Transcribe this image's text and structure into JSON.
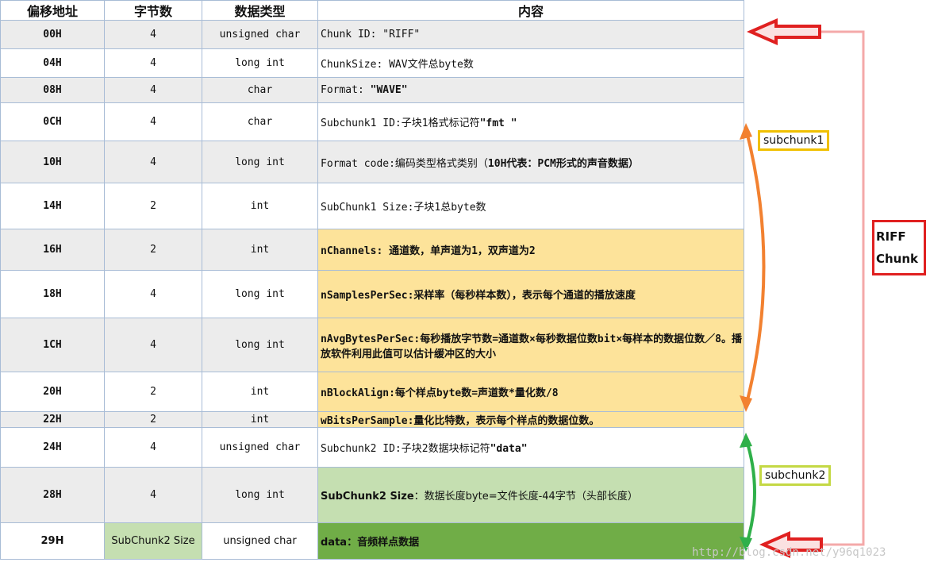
{
  "headers": {
    "offset": "偏移地址",
    "bytes": "字节数",
    "type": "数据类型",
    "content": "内容"
  },
  "rows": [
    {
      "offset": "00H",
      "bytes": "4",
      "type": "unsigned char",
      "desc": "Chunk ID: \"RIFF\""
    },
    {
      "offset": "04H",
      "bytes": "4",
      "type": "long int",
      "desc": "ChunkSize: WAV文件总byte数"
    },
    {
      "offset": "08H",
      "bytes": "4",
      "type": "char",
      "desc_a": "Format: ",
      "desc_b": "\"WAVE\""
    },
    {
      "offset": "0CH",
      "bytes": "4",
      "type": "char",
      "desc_a": "Subchunk1 ID:子块1格式标记符",
      "desc_b": "\"fmt \""
    },
    {
      "offset": "10H",
      "bytes": "4",
      "type": "long int",
      "desc_a": "Format code:编码类型格式类别（",
      "desc_b": "10H代表：PCM形式的声音数据）"
    },
    {
      "offset": "14H",
      "bytes": "2",
      "type": "int",
      "desc": "SubChunk1 Size:子块1总byte数"
    },
    {
      "offset": "16H",
      "bytes": "2",
      "type": "int",
      "desc": "nChannels: 通道数，单声道为1，双声道为2"
    },
    {
      "offset": "18H",
      "bytes": "4",
      "type": "long int",
      "desc": "nSamplesPerSec:采样率（每秒样本数），表示每个通道的播放速度"
    },
    {
      "offset": "1CH",
      "bytes": "4",
      "type": "long int",
      "desc": "nAvgBytesPerSec:每秒播放字节数=通道数×每秒数据位数bit×每样本的数据位数／8。播放软件利用此值可以估计缓冲区的大小"
    },
    {
      "offset": "20H",
      "bytes": "2",
      "type": "int",
      "desc": "nBlockAlign:每个样点byte数=声道数*量化数/8"
    },
    {
      "offset": "22H",
      "bytes": "2",
      "type": "int",
      "desc": " wBitsPerSample:量化比特数，表示每个样点的数据位数。"
    },
    {
      "offset": "24H",
      "bytes": "4",
      "type": "unsigned char",
      "desc_a": "Subchunk2 ID:子块2数据块标记符",
      "desc_b": "\"data\""
    },
    {
      "offset": "28H",
      "bytes": "4",
      "type": "long int",
      "desc_a": "SubChunk2 Size",
      "desc_b": "：数据长度byte=文件长度-44字节（头部长度）"
    },
    {
      "offset": "29H",
      "bytes": "SubChunk2 Size",
      "type": "unsigned char",
      "desc": "data：音频样点数据"
    }
  ],
  "labels": {
    "subchunk1": "subchunk1",
    "subchunk2": "subchunk2",
    "riff_line1": "RIFF",
    "riff_line2": "Chunk"
  },
  "watermark": "http://blog.csdn.net/y96q1023",
  "colors": {
    "orange": "#f28130",
    "green": "#2fb04a",
    "red": "#e02020",
    "pink": "#f4a9a9",
    "yellow": "#fde39a",
    "light_green": "#c5dfb1",
    "dark_green": "#70ad47"
  }
}
